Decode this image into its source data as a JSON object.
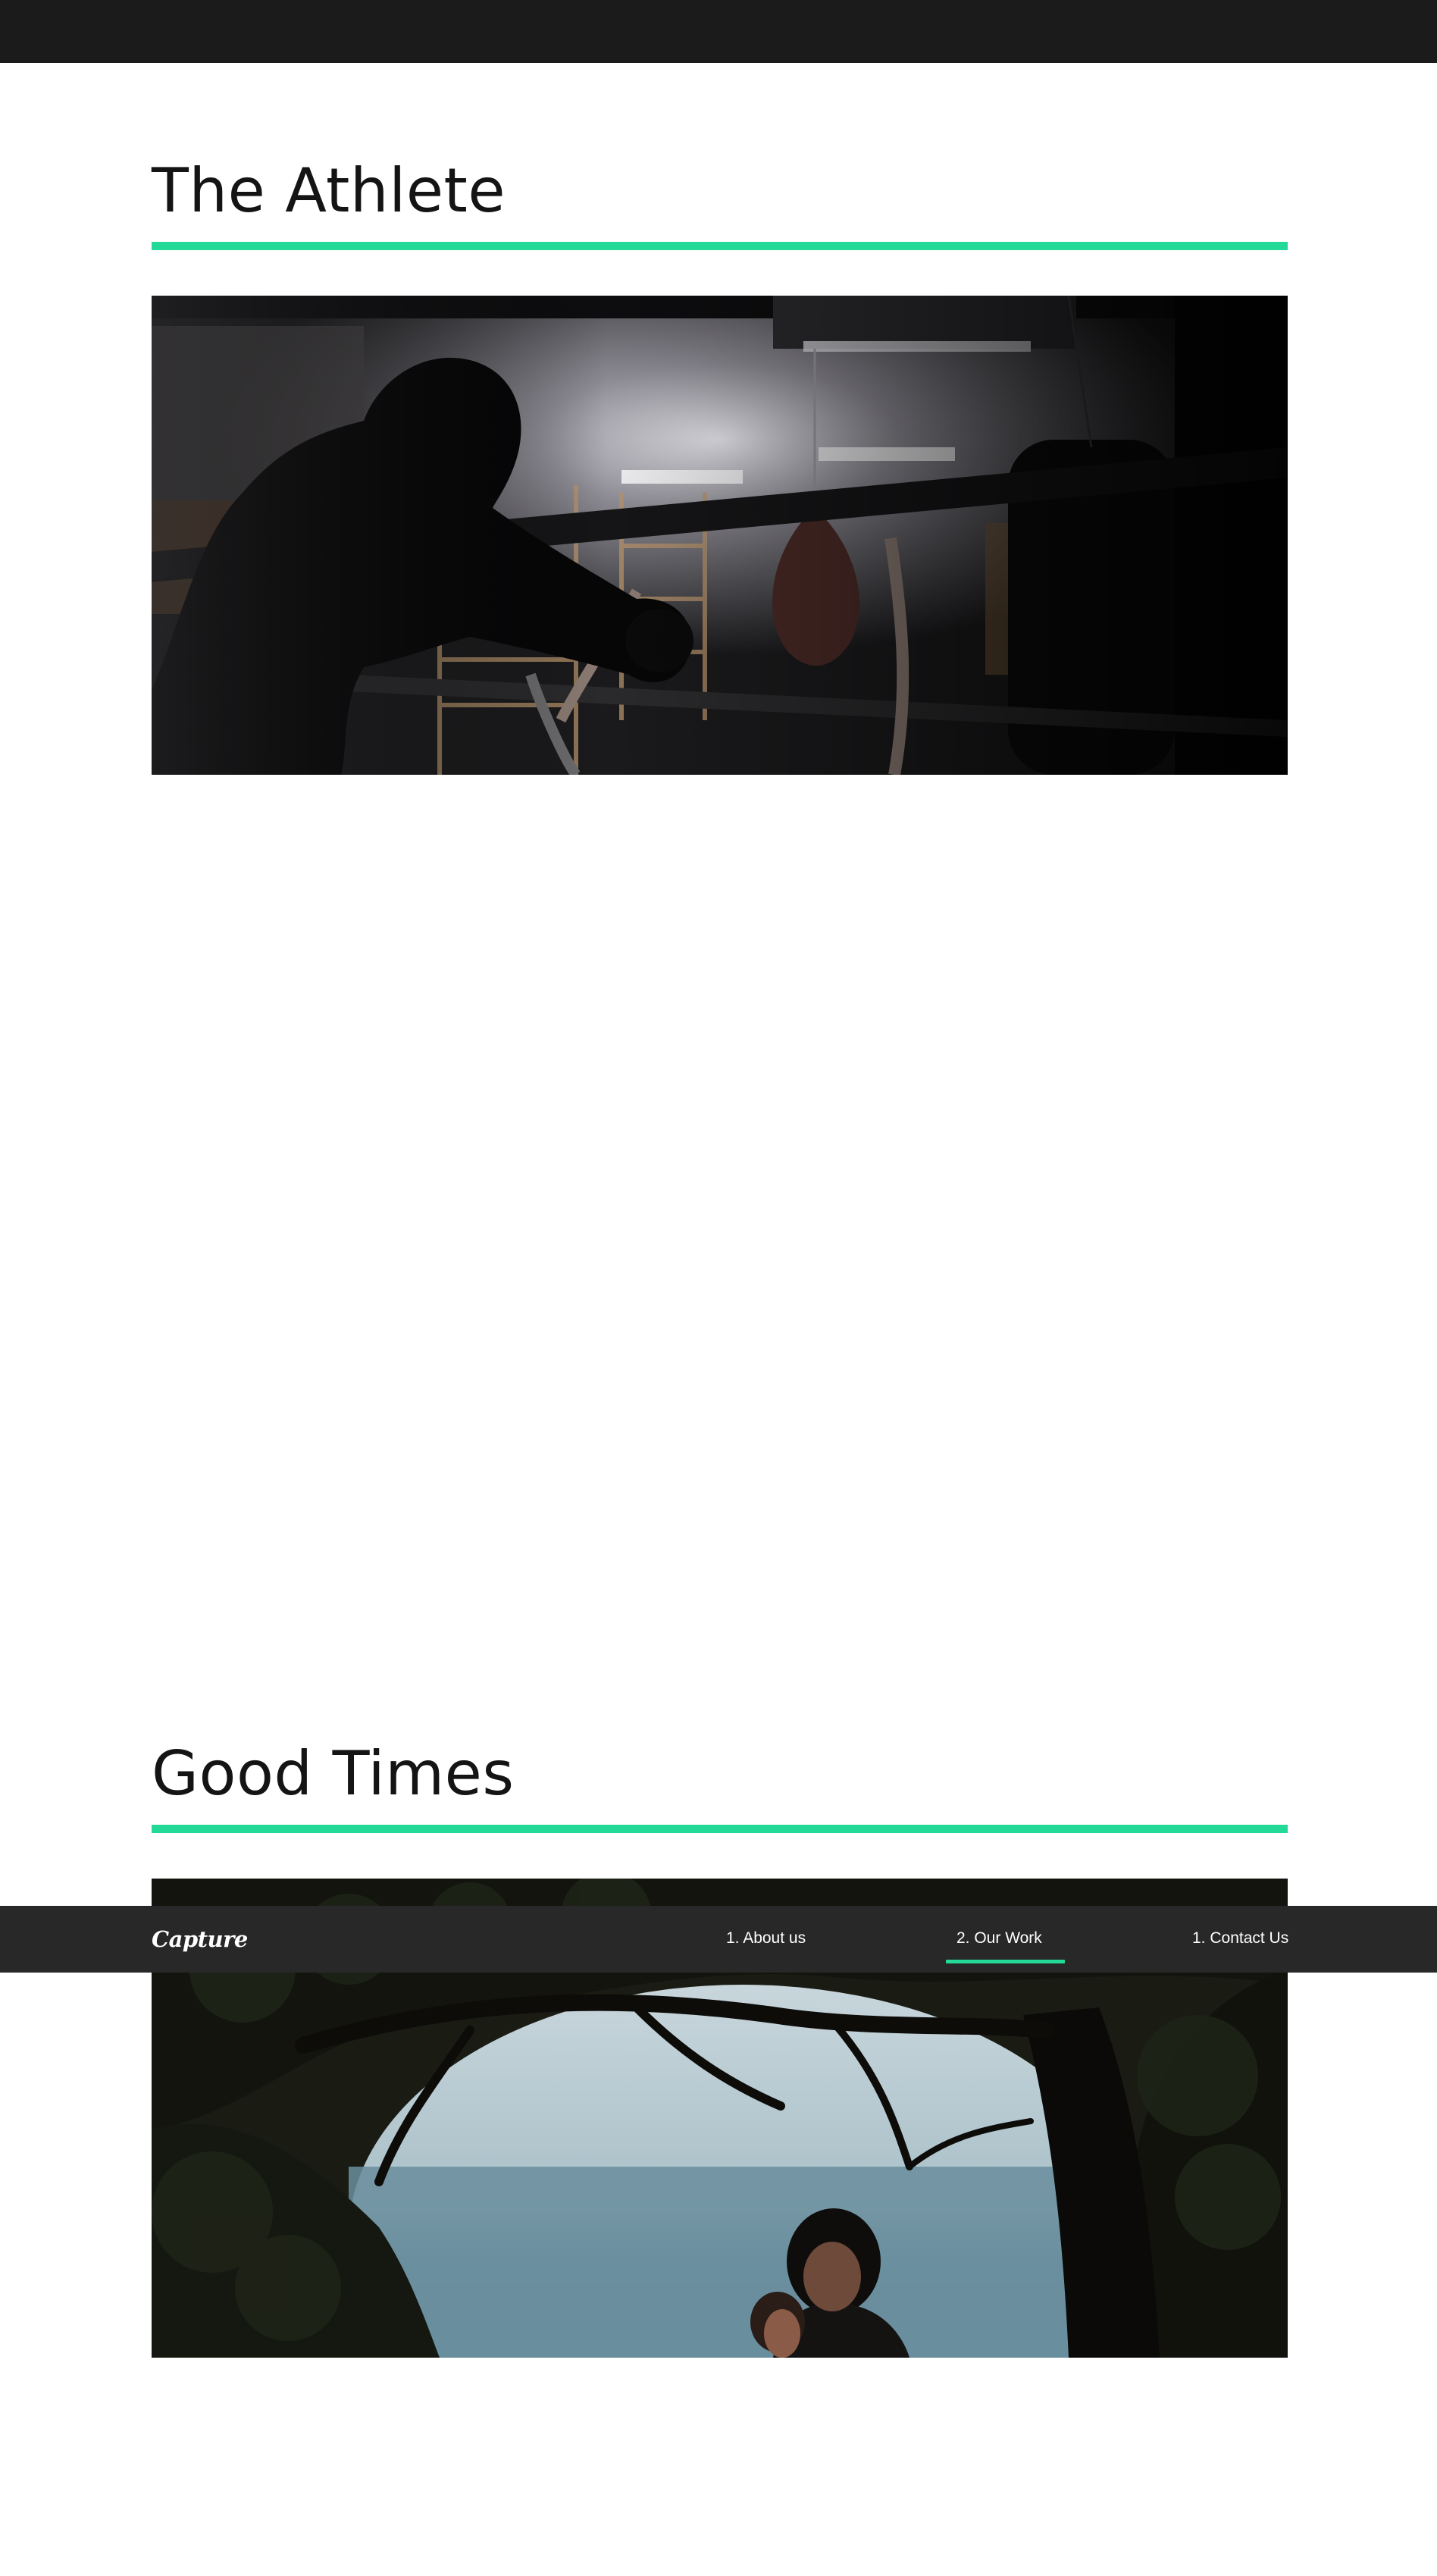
{
  "sections": [
    {
      "title": "The Athlete",
      "image_icon": "boxing-gym-photo"
    },
    {
      "title": "Good Times",
      "image_icon": "couple-under-tree-photo"
    }
  ],
  "nav": {
    "logo": "Capture",
    "links": [
      {
        "label": "1. About us",
        "active": false
      },
      {
        "label": "2. Our Work",
        "active": true
      },
      {
        "label": "1. Contact Us",
        "active": false
      }
    ]
  },
  "colors": {
    "accent": "#23d997",
    "nav_background": "#282828",
    "top_bar": "#1b1b1b"
  }
}
